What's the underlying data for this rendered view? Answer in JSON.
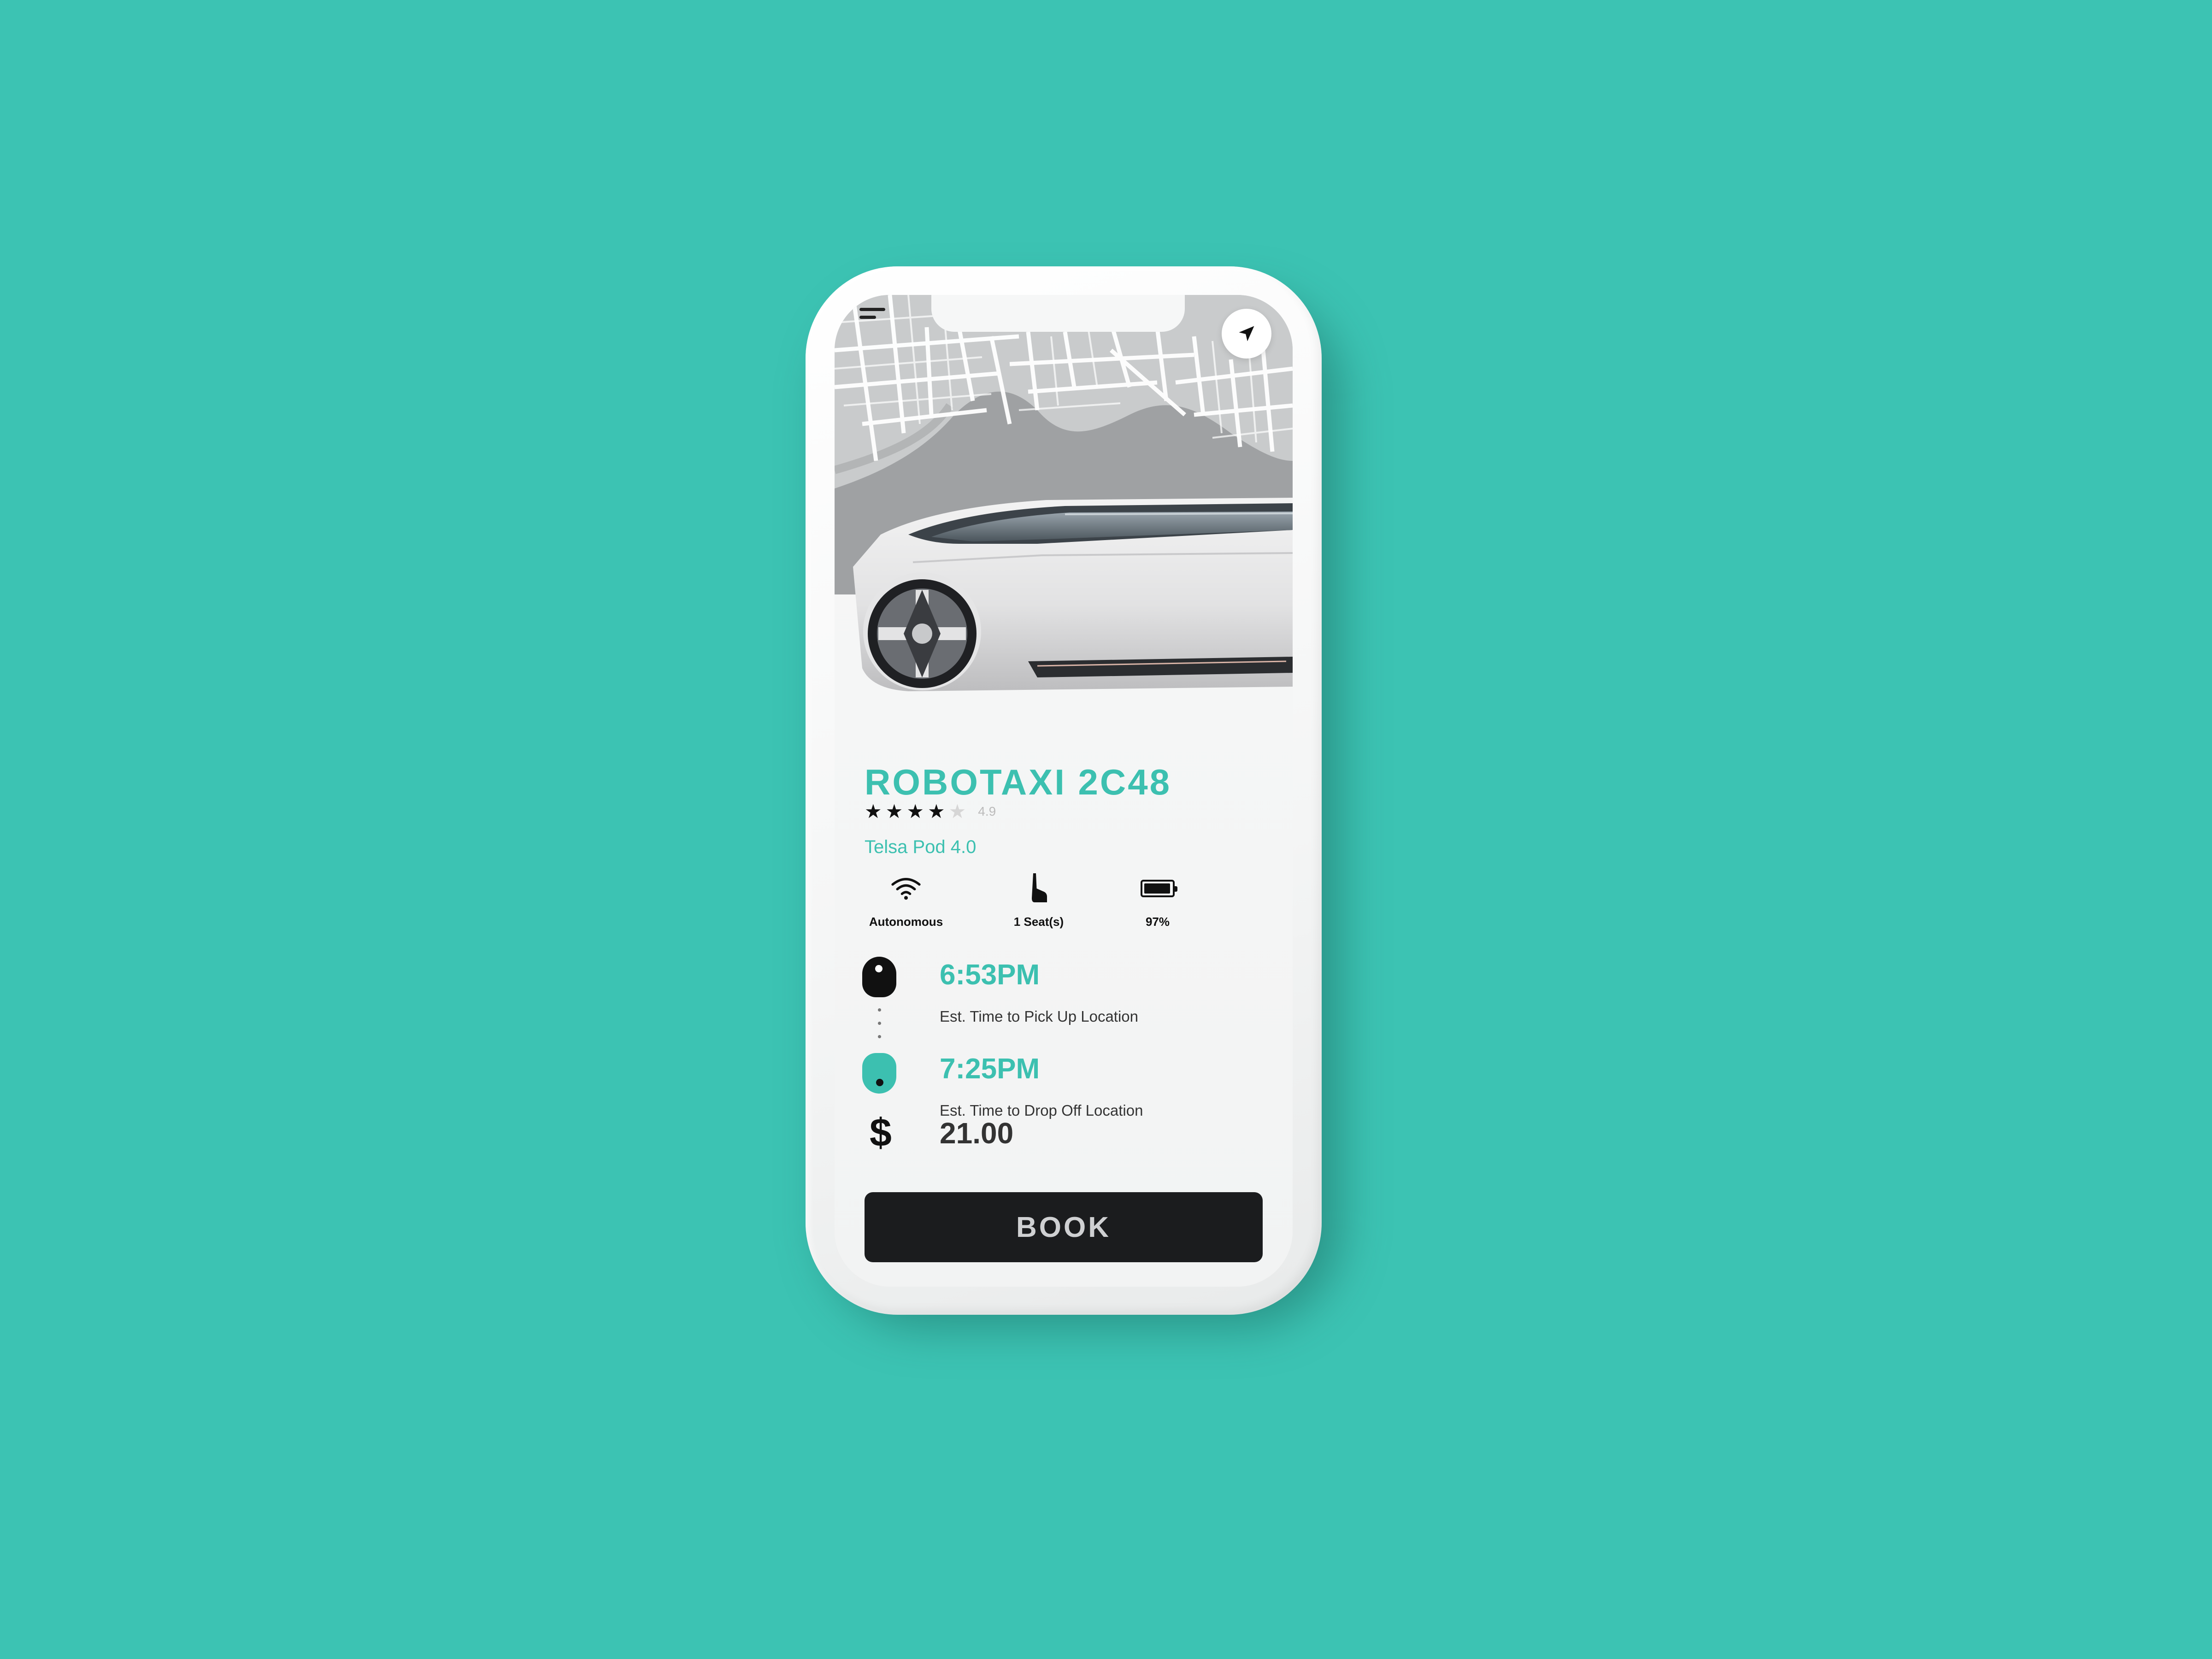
{
  "vehicle": {
    "name": "ROBOTAXI 2C48",
    "rating": 4.9,
    "rating_text": "4.9",
    "stars_filled": 4,
    "stars_total": 5,
    "model": "Telsa Pod 4.0"
  },
  "features": [
    {
      "icon": "wifi-icon",
      "label": "Autonomous"
    },
    {
      "icon": "seat-icon",
      "label": "1 Seat(s)"
    },
    {
      "icon": "battery-icon",
      "label": "97%"
    }
  ],
  "battery_level_percent": 97,
  "trip": {
    "pickup": {
      "time": "6:53PM",
      "label": "Est. Time to Pick Up Location"
    },
    "dropoff": {
      "time": "7:25PM",
      "label": "Est. Time to Drop Off Location"
    },
    "currency_symbol": "$",
    "price": "21.00"
  },
  "actions": {
    "book_label": "BOOK"
  },
  "icons": {
    "menu": "menu-icon",
    "locate": "navigation-arrow-icon"
  },
  "colors": {
    "accent": "#3cc0b0",
    "background": "#3cc3b3",
    "button": "#1b1c1e",
    "button_text": "#cfd0d2"
  }
}
